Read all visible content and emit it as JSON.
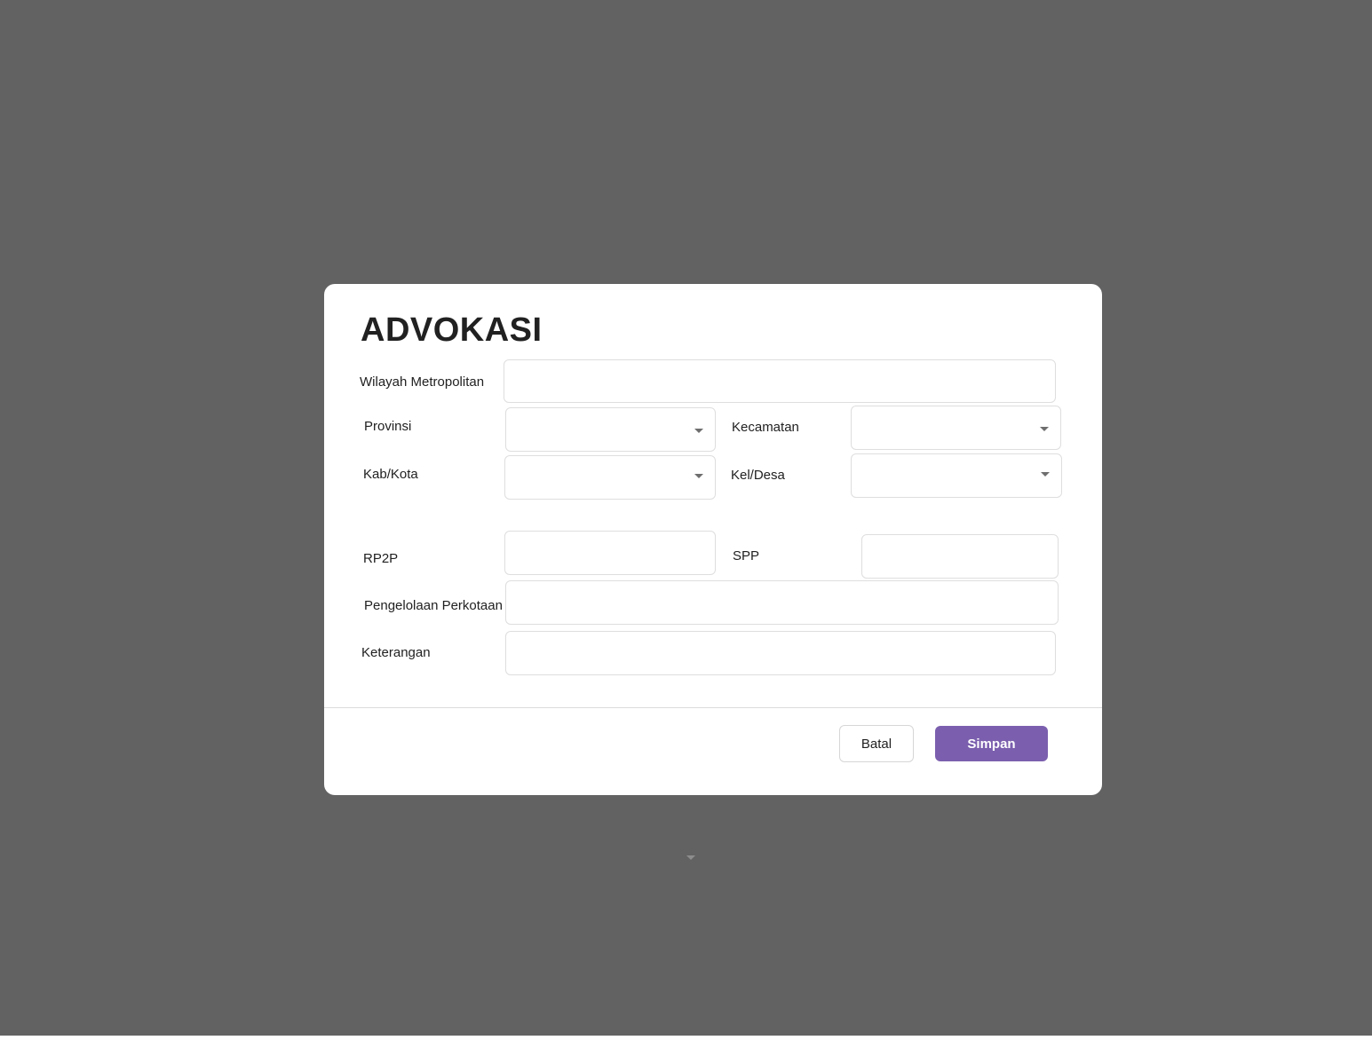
{
  "dialog": {
    "title": "ADVOKASI",
    "fields": {
      "wilayah_metropolitan": {
        "label": "Wilayah Metropolitan",
        "value": ""
      },
      "provinsi": {
        "label": "Provinsi",
        "value": ""
      },
      "kecamatan": {
        "label": "Kecamatan",
        "value": ""
      },
      "kab_kota": {
        "label": "Kab/Kota",
        "value": ""
      },
      "kel_desa": {
        "label": "Kel/Desa",
        "value": ""
      },
      "rp2p": {
        "label": "RP2P",
        "value": ""
      },
      "spp": {
        "label": "SPP",
        "value": ""
      },
      "pengelolaan_perkotaan": {
        "label": "Pengelolaan Perkotaan",
        "value": ""
      },
      "keterangan": {
        "label": "Keterangan",
        "value": ""
      }
    },
    "buttons": {
      "cancel_label": "Batal",
      "save_label": "Simpan"
    }
  },
  "colors": {
    "overlay": "#626262",
    "primary": "#7b5fae",
    "field_border": "#dedede"
  },
  "icons": {
    "dropdown": "chevron-down-icon"
  }
}
